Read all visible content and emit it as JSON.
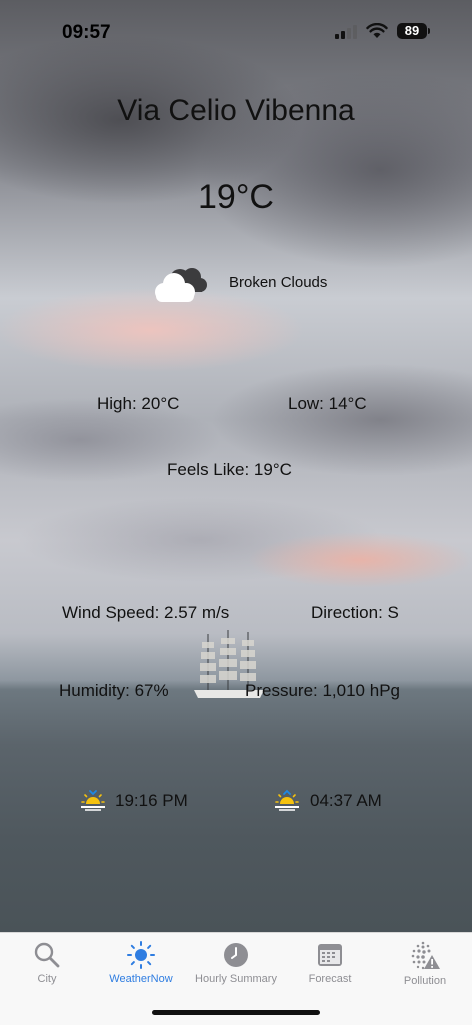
{
  "status_bar": {
    "time": "09:57",
    "battery": "89",
    "icons": [
      "signal-icon",
      "wifi-icon",
      "battery-icon"
    ]
  },
  "weather": {
    "city": "Via Celio Vibenna",
    "temperature": "19°C",
    "condition": "Broken Clouds",
    "condition_icon": "broken-clouds-icon",
    "high": "High: 20°C",
    "low": "Low: 14°C",
    "feels_like": "Feels Like: 19°C",
    "wind_speed": "Wind Speed: 2.57 m/s",
    "direction": "Direction: S",
    "humidity": "Humidity: 67%",
    "pressure": "Pressure: 1,010 hPg",
    "sunset": "19:16 PM",
    "sunrise": "04:37 AM"
  },
  "tabbar": {
    "items": [
      {
        "label": "City",
        "icon": "search-icon",
        "active": false
      },
      {
        "label": "WeatherNow",
        "icon": "sun-icon",
        "active": true
      },
      {
        "label": "Hourly Summary",
        "icon": "clock-icon",
        "active": false
      },
      {
        "label": "Forecast",
        "icon": "calendar-icon",
        "active": false
      },
      {
        "label": "Pollution",
        "icon": "pollution-warning-icon",
        "active": false
      }
    ],
    "active_color": "#2f7de1",
    "inactive_color": "#8e8e93"
  }
}
